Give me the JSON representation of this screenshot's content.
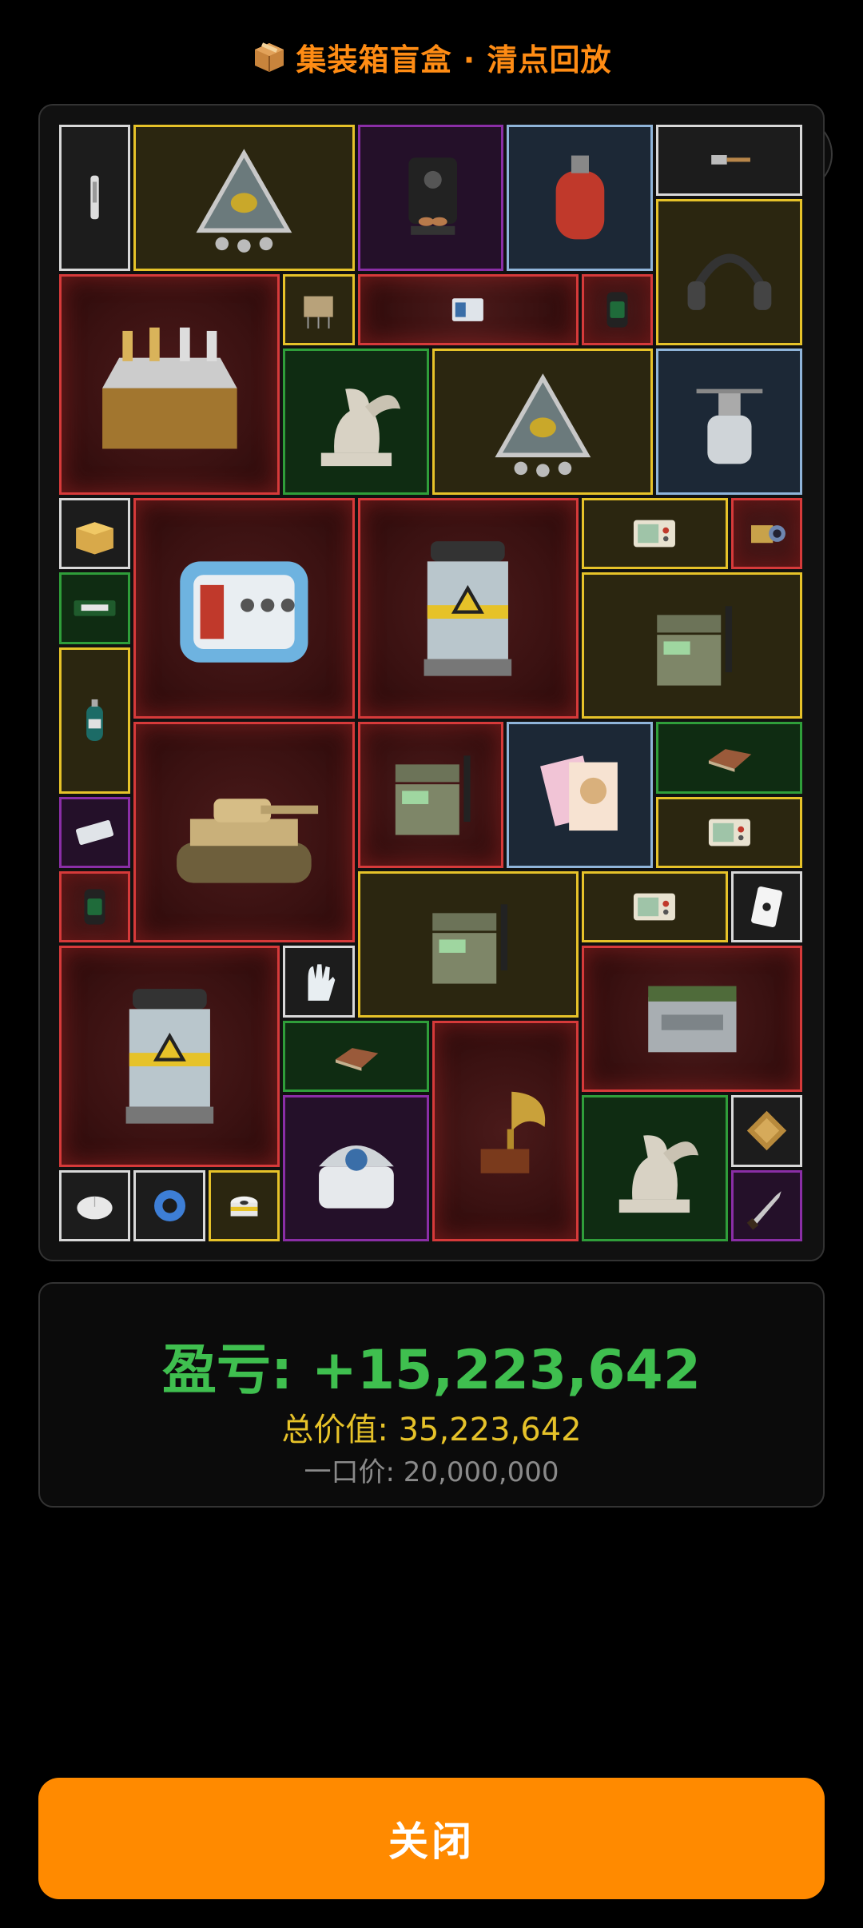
{
  "header": {
    "title": "集装箱盲盒 · 清点回放",
    "icon": "package-icon"
  },
  "menu_capsule": {
    "more_icon": "more-dots-icon",
    "close_icon": "target-circle-icon"
  },
  "summary": {
    "pnl_label": "盈亏: +15,223,642",
    "total_label": "总价值: 35,223,642",
    "price_label": "一口价: 20,000,000",
    "colors": {
      "pnl": "#3fbf4f",
      "total": "#e6c229",
      "price": "#8a8a8a"
    }
  },
  "close_button": {
    "label": "关闭",
    "color": "#ff8a00"
  },
  "rarity_colors": {
    "gold": "#e6c229",
    "red": "#d63a3a",
    "purple": "#8a2ea6",
    "blue": "#8fb4d9",
    "green": "#2f9e3a",
    "white": "#d8d8d8"
  },
  "items": [
    {
      "name": "injector-pen",
      "rarity": "white",
      "icon": "pen-icon"
    },
    {
      "name": "triangle-amulet",
      "rarity": "gold",
      "icon": "amulet-icon"
    },
    {
      "name": "coffee-machine",
      "rarity": "purple",
      "icon": "coffee-icon"
    },
    {
      "name": "gas-canister",
      "rarity": "blue",
      "icon": "gas-tank-icon"
    },
    {
      "name": "hammer",
      "rarity": "white",
      "icon": "hammer-icon"
    },
    {
      "name": "chess-set",
      "rarity": "red",
      "icon": "chess-icon"
    },
    {
      "name": "circuit-module",
      "rarity": "gold",
      "icon": "chip-icon"
    },
    {
      "name": "server-unit",
      "rarity": "red",
      "icon": "server-icon"
    },
    {
      "name": "smart-watch",
      "rarity": "red",
      "icon": "watch-icon"
    },
    {
      "name": "headset",
      "rarity": "gold",
      "icon": "headset-icon"
    },
    {
      "name": "winged-lion-statue",
      "rarity": "green",
      "icon": "statue-icon"
    },
    {
      "name": "triangle-amulet",
      "rarity": "gold",
      "icon": "amulet-icon"
    },
    {
      "name": "camp-stove",
      "rarity": "blue",
      "icon": "stove-icon"
    },
    {
      "name": "cardboard-box",
      "rarity": "white",
      "icon": "box-icon"
    },
    {
      "name": "defibrillator",
      "rarity": "red",
      "icon": "medical-device-icon"
    },
    {
      "name": "reactor-core",
      "rarity": "red",
      "icon": "reactor-icon"
    },
    {
      "name": "control-panel",
      "rarity": "gold",
      "icon": "panel-icon"
    },
    {
      "name": "camera-lens",
      "rarity": "red",
      "icon": "camera-icon"
    },
    {
      "name": "energy-bar",
      "rarity": "green",
      "icon": "bar-icon"
    },
    {
      "name": "military-radio",
      "rarity": "gold",
      "icon": "radio-icon"
    },
    {
      "name": "oxygen-tank",
      "rarity": "gold",
      "icon": "oxygen-icon"
    },
    {
      "name": "battle-tank",
      "rarity": "red",
      "icon": "tank-icon"
    },
    {
      "name": "field-radio",
      "rarity": "red",
      "icon": "radio-icon"
    },
    {
      "name": "magazines",
      "rarity": "blue",
      "icon": "magazine-icon"
    },
    {
      "name": "wood-plank",
      "rarity": "green",
      "icon": "plank-icon"
    },
    {
      "name": "ssd-drive",
      "rarity": "purple",
      "icon": "drive-icon"
    },
    {
      "name": "control-panel",
      "rarity": "gold",
      "icon": "panel-icon"
    },
    {
      "name": "smart-watch",
      "rarity": "red",
      "icon": "watch-icon"
    },
    {
      "name": "military-radio",
      "rarity": "gold",
      "icon": "radio-icon"
    },
    {
      "name": "control-panel",
      "rarity": "gold",
      "icon": "panel-icon"
    },
    {
      "name": "playing-card",
      "rarity": "white",
      "icon": "card-icon"
    },
    {
      "name": "reactor-core",
      "rarity": "red",
      "icon": "reactor-icon"
    },
    {
      "name": "glove",
      "rarity": "white",
      "icon": "glove-icon"
    },
    {
      "name": "ammo-crate",
      "rarity": "red",
      "icon": "crate-icon"
    },
    {
      "name": "wood-plank",
      "rarity": "green",
      "icon": "plank-icon"
    },
    {
      "name": "gramophone",
      "rarity": "red",
      "icon": "gramophone-icon"
    },
    {
      "name": "centrifuge",
      "rarity": "purple",
      "icon": "centrifuge-icon"
    },
    {
      "name": "winged-lion-statue",
      "rarity": "green",
      "icon": "statue-icon"
    },
    {
      "name": "pillow",
      "rarity": "white",
      "icon": "pillow-icon"
    },
    {
      "name": "computer-mouse",
      "rarity": "white",
      "icon": "mouse-icon"
    },
    {
      "name": "tape-roll",
      "rarity": "white",
      "icon": "tape-icon"
    },
    {
      "name": "toilet-paper",
      "rarity": "gold",
      "icon": "roll-icon"
    },
    {
      "name": "knife",
      "rarity": "purple",
      "icon": "knife-icon"
    }
  ]
}
